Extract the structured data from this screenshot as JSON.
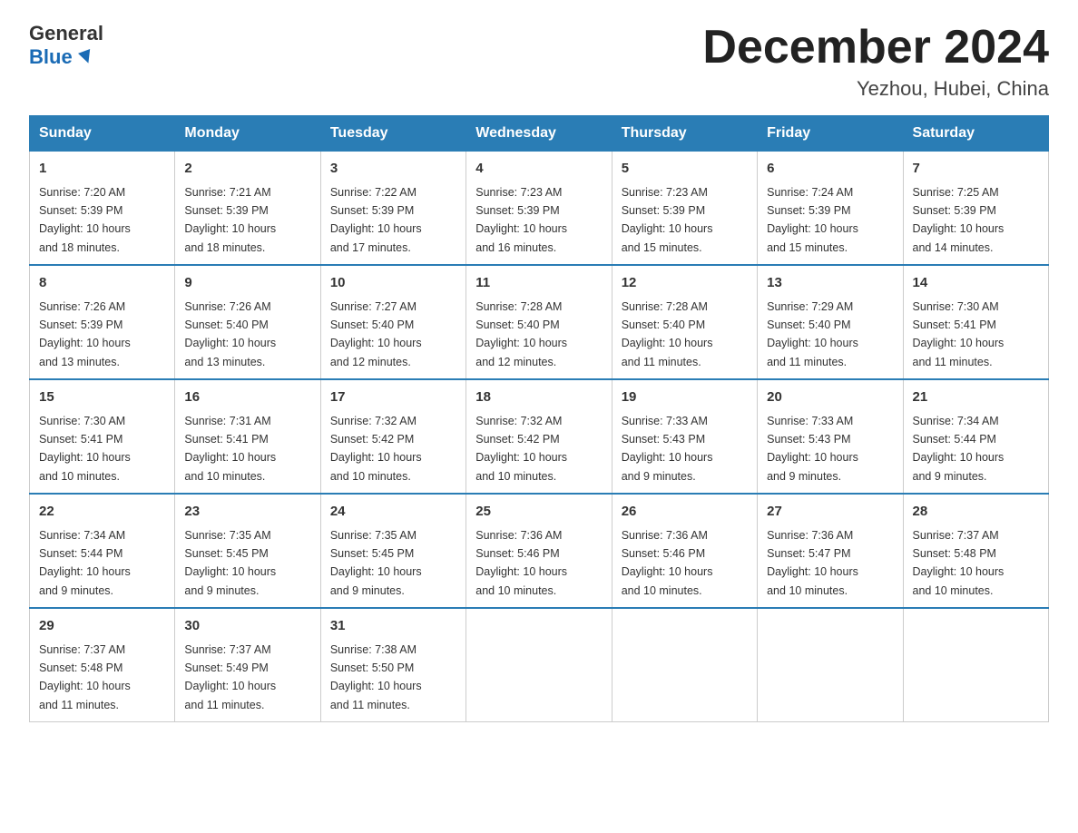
{
  "logo": {
    "general": "General",
    "blue": "Blue"
  },
  "title": "December 2024",
  "subtitle": "Yezhou, Hubei, China",
  "days_of_week": [
    "Sunday",
    "Monday",
    "Tuesday",
    "Wednesday",
    "Thursday",
    "Friday",
    "Saturday"
  ],
  "weeks": [
    [
      {
        "day": "1",
        "sunrise": "7:20 AM",
        "sunset": "5:39 PM",
        "daylight": "10 hours and 18 minutes."
      },
      {
        "day": "2",
        "sunrise": "7:21 AM",
        "sunset": "5:39 PM",
        "daylight": "10 hours and 18 minutes."
      },
      {
        "day": "3",
        "sunrise": "7:22 AM",
        "sunset": "5:39 PM",
        "daylight": "10 hours and 17 minutes."
      },
      {
        "day": "4",
        "sunrise": "7:23 AM",
        "sunset": "5:39 PM",
        "daylight": "10 hours and 16 minutes."
      },
      {
        "day": "5",
        "sunrise": "7:23 AM",
        "sunset": "5:39 PM",
        "daylight": "10 hours and 15 minutes."
      },
      {
        "day": "6",
        "sunrise": "7:24 AM",
        "sunset": "5:39 PM",
        "daylight": "10 hours and 15 minutes."
      },
      {
        "day": "7",
        "sunrise": "7:25 AM",
        "sunset": "5:39 PM",
        "daylight": "10 hours and 14 minutes."
      }
    ],
    [
      {
        "day": "8",
        "sunrise": "7:26 AM",
        "sunset": "5:39 PM",
        "daylight": "10 hours and 13 minutes."
      },
      {
        "day": "9",
        "sunrise": "7:26 AM",
        "sunset": "5:40 PM",
        "daylight": "10 hours and 13 minutes."
      },
      {
        "day": "10",
        "sunrise": "7:27 AM",
        "sunset": "5:40 PM",
        "daylight": "10 hours and 12 minutes."
      },
      {
        "day": "11",
        "sunrise": "7:28 AM",
        "sunset": "5:40 PM",
        "daylight": "10 hours and 12 minutes."
      },
      {
        "day": "12",
        "sunrise": "7:28 AM",
        "sunset": "5:40 PM",
        "daylight": "10 hours and 11 minutes."
      },
      {
        "day": "13",
        "sunrise": "7:29 AM",
        "sunset": "5:40 PM",
        "daylight": "10 hours and 11 minutes."
      },
      {
        "day": "14",
        "sunrise": "7:30 AM",
        "sunset": "5:41 PM",
        "daylight": "10 hours and 11 minutes."
      }
    ],
    [
      {
        "day": "15",
        "sunrise": "7:30 AM",
        "sunset": "5:41 PM",
        "daylight": "10 hours and 10 minutes."
      },
      {
        "day": "16",
        "sunrise": "7:31 AM",
        "sunset": "5:41 PM",
        "daylight": "10 hours and 10 minutes."
      },
      {
        "day": "17",
        "sunrise": "7:32 AM",
        "sunset": "5:42 PM",
        "daylight": "10 hours and 10 minutes."
      },
      {
        "day": "18",
        "sunrise": "7:32 AM",
        "sunset": "5:42 PM",
        "daylight": "10 hours and 10 minutes."
      },
      {
        "day": "19",
        "sunrise": "7:33 AM",
        "sunset": "5:43 PM",
        "daylight": "10 hours and 9 minutes."
      },
      {
        "day": "20",
        "sunrise": "7:33 AM",
        "sunset": "5:43 PM",
        "daylight": "10 hours and 9 minutes."
      },
      {
        "day": "21",
        "sunrise": "7:34 AM",
        "sunset": "5:44 PM",
        "daylight": "10 hours and 9 minutes."
      }
    ],
    [
      {
        "day": "22",
        "sunrise": "7:34 AM",
        "sunset": "5:44 PM",
        "daylight": "10 hours and 9 minutes."
      },
      {
        "day": "23",
        "sunrise": "7:35 AM",
        "sunset": "5:45 PM",
        "daylight": "10 hours and 9 minutes."
      },
      {
        "day": "24",
        "sunrise": "7:35 AM",
        "sunset": "5:45 PM",
        "daylight": "10 hours and 9 minutes."
      },
      {
        "day": "25",
        "sunrise": "7:36 AM",
        "sunset": "5:46 PM",
        "daylight": "10 hours and 10 minutes."
      },
      {
        "day": "26",
        "sunrise": "7:36 AM",
        "sunset": "5:46 PM",
        "daylight": "10 hours and 10 minutes."
      },
      {
        "day": "27",
        "sunrise": "7:36 AM",
        "sunset": "5:47 PM",
        "daylight": "10 hours and 10 minutes."
      },
      {
        "day": "28",
        "sunrise": "7:37 AM",
        "sunset": "5:48 PM",
        "daylight": "10 hours and 10 minutes."
      }
    ],
    [
      {
        "day": "29",
        "sunrise": "7:37 AM",
        "sunset": "5:48 PM",
        "daylight": "10 hours and 11 minutes."
      },
      {
        "day": "30",
        "sunrise": "7:37 AM",
        "sunset": "5:49 PM",
        "daylight": "10 hours and 11 minutes."
      },
      {
        "day": "31",
        "sunrise": "7:38 AM",
        "sunset": "5:50 PM",
        "daylight": "10 hours and 11 minutes."
      },
      null,
      null,
      null,
      null
    ]
  ],
  "labels": {
    "sunrise": "Sunrise:",
    "sunset": "Sunset:",
    "daylight": "Daylight:"
  }
}
